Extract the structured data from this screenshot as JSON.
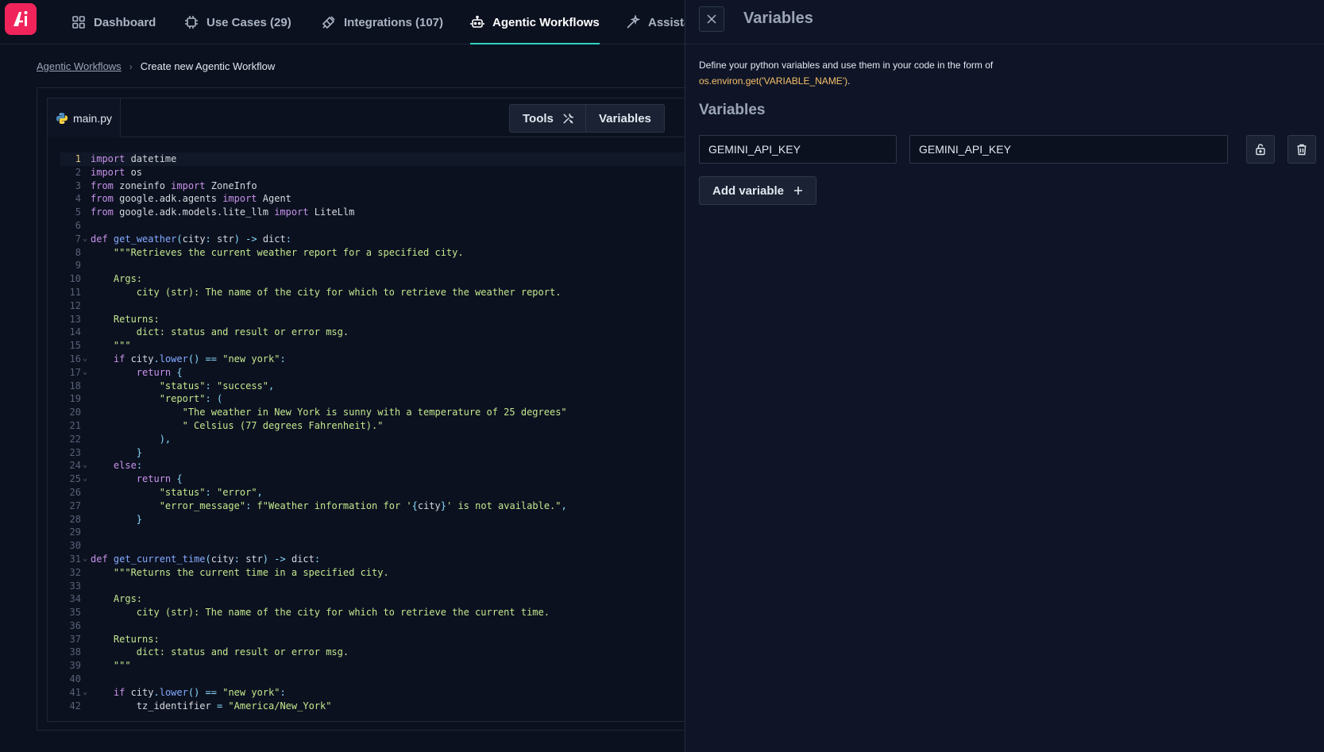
{
  "nav": {
    "tabs": [
      {
        "label": "Dashboard",
        "icon": "grid-icon"
      },
      {
        "label": "Use Cases (29)",
        "icon": "chip-icon"
      },
      {
        "label": "Integrations (107)",
        "icon": "plug-icon"
      },
      {
        "label": "Agentic Workflows",
        "icon": "robot-icon",
        "active": true
      },
      {
        "label": "Assista",
        "icon": "sparkle-icon"
      }
    ],
    "accent_color": "#2dd4bf",
    "logo_color": "#f0245b"
  },
  "breadcrumb": {
    "parent": "Agentic Workflows",
    "current": "Create new Agentic Workflow"
  },
  "editor": {
    "file_name": "main.py",
    "tools_label": "Tools",
    "variables_label": "Variables",
    "current_line": 1,
    "lines": [
      {
        "n": "1",
        "fold": "",
        "html": "<span class='kw'>import</span> datetime"
      },
      {
        "n": "2",
        "fold": "",
        "html": "<span class='kw'>import</span> os"
      },
      {
        "n": "3",
        "fold": "",
        "html": "<span class='kw'>from</span> zoneinfo <span class='kw'>import</span> ZoneInfo"
      },
      {
        "n": "4",
        "fold": "",
        "html": "<span class='kw'>from</span> google.adk.agents <span class='kw'>import</span> Agent"
      },
      {
        "n": "5",
        "fold": "",
        "html": "<span class='kw'>from</span> google.adk.models.lite_llm <span class='kw'>import</span> LiteLlm"
      },
      {
        "n": "6",
        "fold": "",
        "html": ""
      },
      {
        "n": "7",
        "fold": "⌄",
        "html": "<span class='kw'>def</span> <span class='fn'>get_weather</span><span class='op'>(</span>city<span class='op'>:</span> str<span class='op'>)</span> <span class='op'>-&gt;</span> dict<span class='op'>:</span>"
      },
      {
        "n": "8",
        "fold": "",
        "html": "    <span class='str'>\"\"\"Retrieves the current weather report for a specified city.</span>"
      },
      {
        "n": "9",
        "fold": "",
        "html": ""
      },
      {
        "n": "10",
        "fold": "",
        "html": "<span class='str'>    Args:</span>"
      },
      {
        "n": "11",
        "fold": "",
        "html": "<span class='str'>        city (str): The name of the city for which to retrieve the weather report.</span>"
      },
      {
        "n": "12",
        "fold": "",
        "html": ""
      },
      {
        "n": "13",
        "fold": "",
        "html": "<span class='str'>    Returns:</span>"
      },
      {
        "n": "14",
        "fold": "",
        "html": "<span class='str'>        dict: status and result or error msg.</span>"
      },
      {
        "n": "15",
        "fold": "",
        "html": "<span class='str'>    \"\"\"</span>"
      },
      {
        "n": "16",
        "fold": "⌄",
        "html": "    <span class='kw'>if</span> city<span class='op'>.</span><span class='fn'>lower</span><span class='op'>()</span> <span class='op'>==</span> <span class='str'>\"new york\"</span><span class='op'>:</span>"
      },
      {
        "n": "17",
        "fold": "⌄",
        "html": "        <span class='kw'>return</span> <span class='op'>{</span>"
      },
      {
        "n": "18",
        "fold": "",
        "html": "            <span class='str'>\"status\"</span><span class='op'>:</span> <span class='str'>\"success\"</span><span class='op'>,</span>"
      },
      {
        "n": "19",
        "fold": "",
        "html": "            <span class='str'>\"report\"</span><span class='op'>:</span> <span class='op'>(</span>"
      },
      {
        "n": "20",
        "fold": "",
        "html": "                <span class='str'>\"The weather in New York is sunny with a temperature of 25 degrees\"</span>"
      },
      {
        "n": "21",
        "fold": "",
        "html": "                <span class='str'>\" Celsius (77 degrees Fahrenheit).\"</span>"
      },
      {
        "n": "22",
        "fold": "",
        "html": "            <span class='op'>),</span>"
      },
      {
        "n": "23",
        "fold": "",
        "html": "        <span class='op'>}</span>"
      },
      {
        "n": "24",
        "fold": "⌄",
        "html": "    <span class='kw'>else</span><span class='op'>:</span>"
      },
      {
        "n": "25",
        "fold": "⌄",
        "html": "        <span class='kw'>return</span> <span class='op'>{</span>"
      },
      {
        "n": "26",
        "fold": "",
        "html": "            <span class='str'>\"status\"</span><span class='op'>:</span> <span class='str'>\"error\"</span><span class='op'>,</span>"
      },
      {
        "n": "27",
        "fold": "",
        "html": "            <span class='str'>\"error_message\"</span><span class='op'>:</span> <span class='str'>f\"Weather information for '</span><span class='op'>{</span>city<span class='op'>}</span><span class='str'>' is not available.\"</span><span class='op'>,</span>"
      },
      {
        "n": "28",
        "fold": "",
        "html": "        <span class='op'>}</span>"
      },
      {
        "n": "29",
        "fold": "",
        "html": ""
      },
      {
        "n": "30",
        "fold": "",
        "html": ""
      },
      {
        "n": "31",
        "fold": "⌄",
        "html": "<span class='kw'>def</span> <span class='fn'>get_current_time</span><span class='op'>(</span>city<span class='op'>:</span> str<span class='op'>)</span> <span class='op'>-&gt;</span> dict<span class='op'>:</span>"
      },
      {
        "n": "32",
        "fold": "",
        "html": "    <span class='str'>\"\"\"Returns the current time in a specified city.</span>"
      },
      {
        "n": "33",
        "fold": "",
        "html": ""
      },
      {
        "n": "34",
        "fold": "",
        "html": "<span class='str'>    Args:</span>"
      },
      {
        "n": "35",
        "fold": "",
        "html": "<span class='str'>        city (str): The name of the city for which to retrieve the current time.</span>"
      },
      {
        "n": "36",
        "fold": "",
        "html": ""
      },
      {
        "n": "37",
        "fold": "",
        "html": "<span class='str'>    Returns:</span>"
      },
      {
        "n": "38",
        "fold": "",
        "html": "<span class='str'>        dict: status and result or error msg.</span>"
      },
      {
        "n": "39",
        "fold": "",
        "html": "<span class='str'>    \"\"\"</span>"
      },
      {
        "n": "40",
        "fold": "",
        "html": ""
      },
      {
        "n": "41",
        "fold": "⌄",
        "html": "    <span class='kw'>if</span> city<span class='op'>.</span><span class='fn'>lower</span><span class='op'>()</span> <span class='op'>==</span> <span class='str'>\"new york\"</span><span class='op'>:</span>"
      },
      {
        "n": "42",
        "fold": "",
        "html": "        tz_identifier <span class='op'>=</span> <span class='str'>\"America/New_York\"</span>"
      }
    ]
  },
  "panel": {
    "title": "Variables",
    "description": "Define your python variables and use them in your code in the form of",
    "code_ref": "os.environ.get('VARIABLE_NAME')",
    "code_ref_suffix": ".",
    "section_title": "Variables",
    "variables": [
      {
        "name": "GEMINI_API_KEY",
        "value": "GEMINI_API_KEY"
      }
    ],
    "add_label": "Add variable"
  }
}
